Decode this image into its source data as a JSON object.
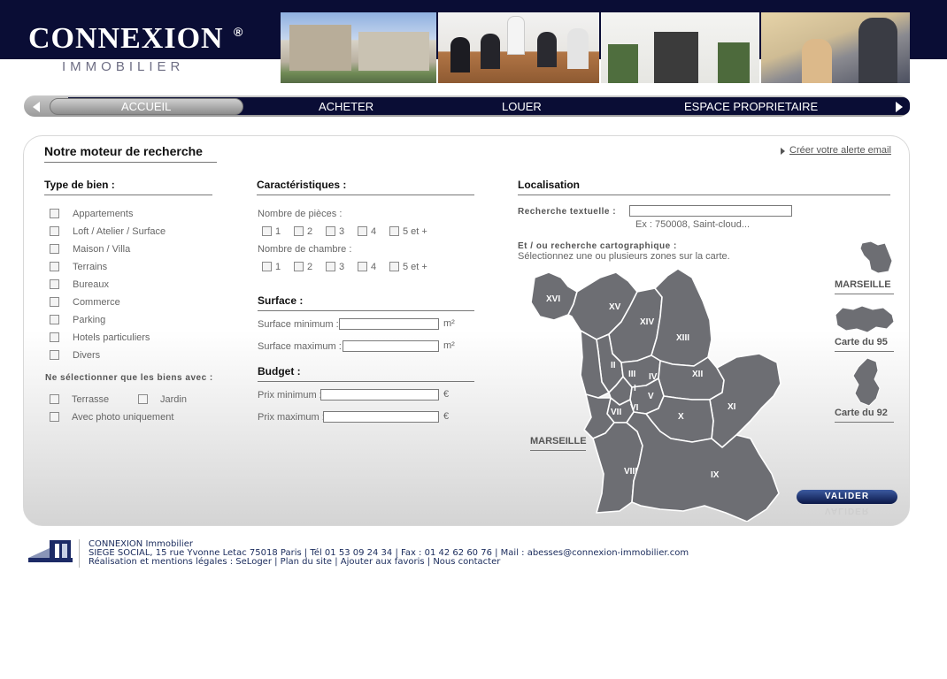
{
  "brand": {
    "name": "CONNEXION",
    "registered": "®",
    "subtitle": "IMMOBILIER"
  },
  "nav": {
    "items": [
      "ACCUEIL",
      "ACHETER",
      "LOUER",
      "ESPACE PROPRIETAIRE"
    ],
    "active": "ACCUEIL"
  },
  "search": {
    "title": "Notre moteur de recherche",
    "alert_link": "Créer votre alerte email",
    "type_de_bien": {
      "title": "Type de bien :",
      "options": [
        "Appartements",
        "Loft / Atelier / Surface",
        "Maison / Villa",
        "Terrains",
        "Bureaux",
        "Commerce",
        "Parking",
        "Hotels particuliers",
        "Divers"
      ],
      "filter_title": "Ne sélectionner que les biens avec :",
      "filter_terrasse": "Terrasse",
      "filter_jardin": "Jardin",
      "filter_photo": "Avec photo uniquement"
    },
    "caracteristiques": {
      "title": "Caractéristiques :",
      "pieces_label": "Nombre de pièces :",
      "chambres_label": "Nombre de chambre :",
      "counts": [
        "1",
        "2",
        "3",
        "4",
        "5 et +"
      ]
    },
    "surface": {
      "title": "Surface :",
      "min_label": "Surface minimum :",
      "max_label": "Surface maximum :",
      "unit": "m²"
    },
    "budget": {
      "title": "Budget :",
      "min_label": "Prix minimum :",
      "max_label": "Prix maximum :",
      "unit": "€"
    },
    "localisation": {
      "title": "Localisation",
      "text_label": "Recherche textuelle :",
      "text_hint": "Ex : 750008, Saint-cloud...",
      "carto_title": "Et / ou recherche cartographique :",
      "carto_hint": "Sélectionnez une ou plusieurs zones sur la carte.",
      "map_caption": "MARSEILLE",
      "districts": [
        "XVI",
        "XV",
        "XIV",
        "XIII",
        "III",
        "IV",
        "II",
        "I",
        "XII",
        "XI",
        "V",
        "VI",
        "VII",
        "X",
        "VIII",
        "IX"
      ],
      "side_maps": [
        "MARSEILLE",
        "Carte du 95",
        "Carte du 92"
      ]
    },
    "submit": "VALIDER"
  },
  "footer": {
    "logo_text": "CONNEXION",
    "company": "CONNEXION Immobilier",
    "address": "SIEGE SOCIAL, 15 rue Yvonne Letac 75018 Paris | Tél 01 53 09 24 34 | Fax : 01 42 62 60 76 | Mail : abesses@connexion-immobilier.com",
    "links": [
      "Réalisation et mentions légales : SeLoger",
      "Plan du site",
      "Ajouter aux favoris",
      "Nous contacter"
    ]
  },
  "colors": {
    "header": "#0a0d35",
    "map": "#6d6e73",
    "submit": "#1b2f6e"
  }
}
